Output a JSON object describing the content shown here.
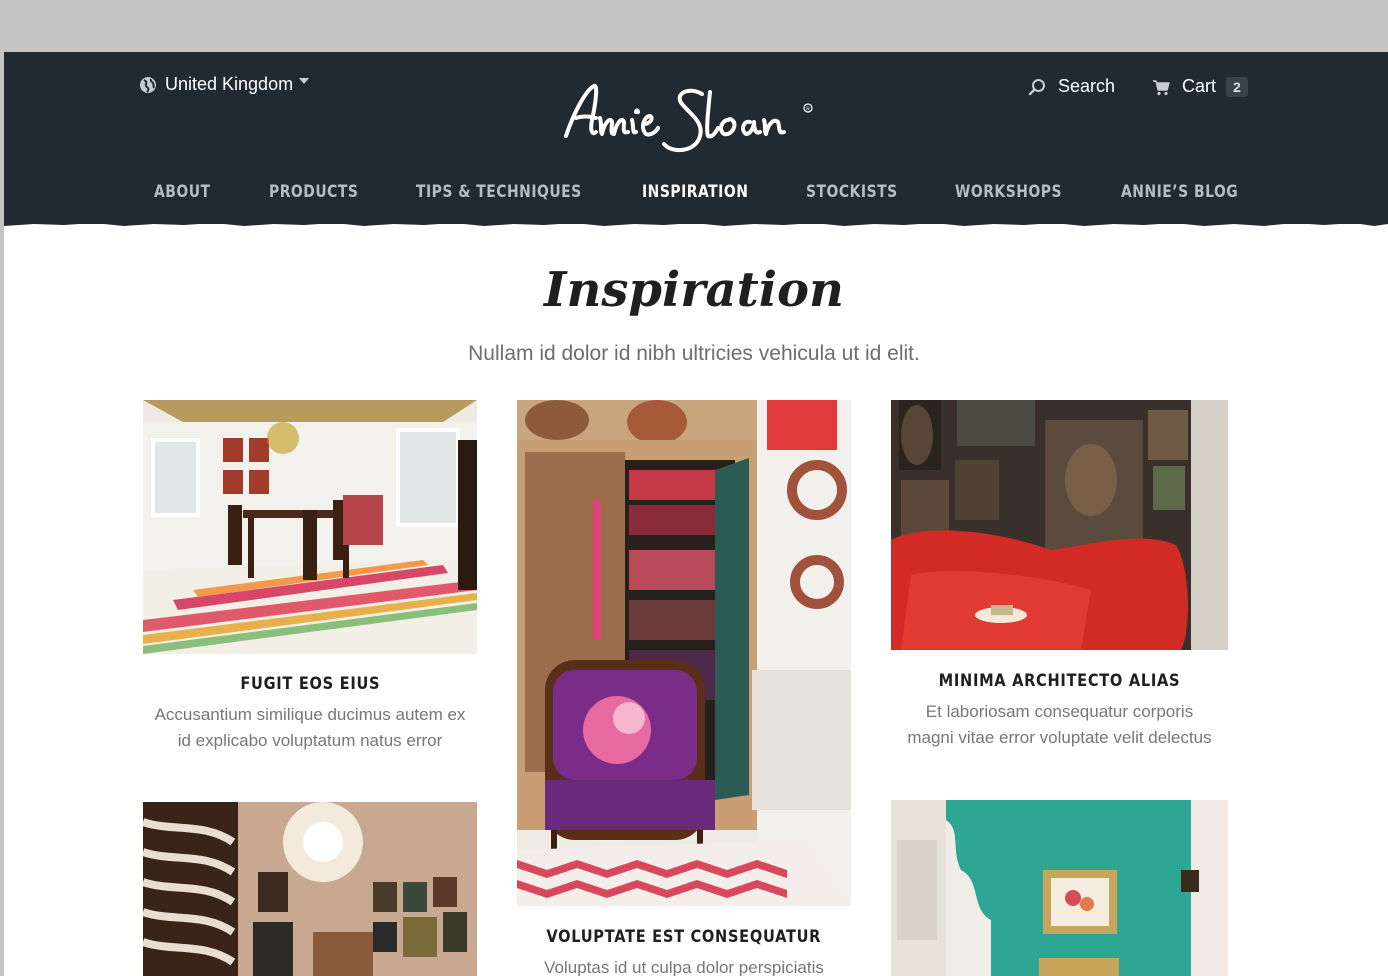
{
  "header": {
    "region": "United Kingdom",
    "logo_text": "Annie Sloan",
    "search_label": "Search",
    "cart_label": "Cart",
    "cart_count": "2"
  },
  "nav": [
    {
      "label": "ABOUT"
    },
    {
      "label": "PRODUCTS"
    },
    {
      "label": "TIPS & TECHNIQUES"
    },
    {
      "label": "INSPIRATION"
    },
    {
      "label": "STOCKISTS"
    },
    {
      "label": "WORKSHOPS"
    },
    {
      "label": "ANNIE’S BLOG"
    }
  ],
  "page": {
    "title": "Inspiration",
    "subtitle": "Nullam id dolor id nibh ultricies vehicula ut id elit."
  },
  "cards": [
    {
      "title": "FUGIT EOS EIUS",
      "desc_line1": "Accusantium similique ducimus autem ex",
      "desc_line2": "id explicabo voluptatum natus error"
    },
    {
      "title": "VOLUPTATE EST CONSEQUATUR",
      "desc_line1": "Voluptas id ut culpa dolor perspiciatis"
    },
    {
      "title": "MINIMA ARCHITECTO ALIAS",
      "desc_line1": "Et laboriosam consequatur corporis",
      "desc_line2": "magni vitae error voluptate velit delectus"
    }
  ],
  "colors": {
    "header_bg": "#1f2a33",
    "nav_text": "#b5bdc4",
    "nav_active": "#ffffff"
  },
  "icons": {
    "region": "globe-icon",
    "search": "magnifier-icon",
    "cart": "cart-icon"
  }
}
